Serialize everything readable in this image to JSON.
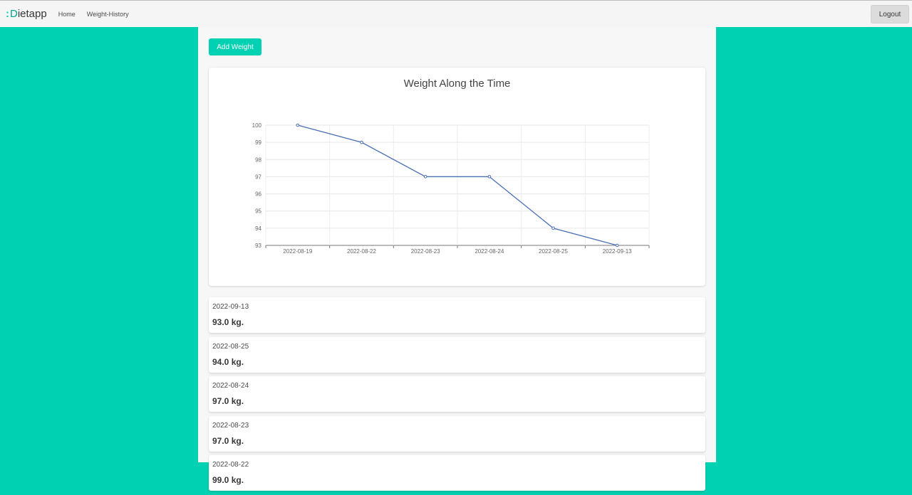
{
  "navbar": {
    "brand_prefix": ":",
    "brand_d": "D",
    "brand_rest": "ietapp",
    "links": [
      "Home",
      "Weight-History"
    ],
    "logout_label": "Logout"
  },
  "actions": {
    "add_weight_label": "Add Weight"
  },
  "colors": {
    "accent": "#00d1b2",
    "line": "#4a6fb5"
  },
  "chart_data": {
    "type": "line",
    "title": "Weight Along the Time",
    "categories": [
      "2022-08-19",
      "2022-08-22",
      "2022-08-23",
      "2022-08-24",
      "2022-08-25",
      "2022-09-13"
    ],
    "series": [
      {
        "values": [
          100,
          99,
          97,
          97,
          94,
          93
        ]
      }
    ],
    "ylim": [
      93,
      100
    ],
    "yticks": [
      100,
      99,
      98,
      97,
      96,
      95,
      94,
      93
    ],
    "grid": true,
    "legend": "none"
  },
  "entries": [
    {
      "date": "2022-09-13",
      "weight": "93.0 kg."
    },
    {
      "date": "2022-08-25",
      "weight": "94.0 kg."
    },
    {
      "date": "2022-08-24",
      "weight": "97.0 kg."
    },
    {
      "date": "2022-08-23",
      "weight": "97.0 kg."
    },
    {
      "date": "2022-08-22",
      "weight": "99.0 kg."
    }
  ]
}
